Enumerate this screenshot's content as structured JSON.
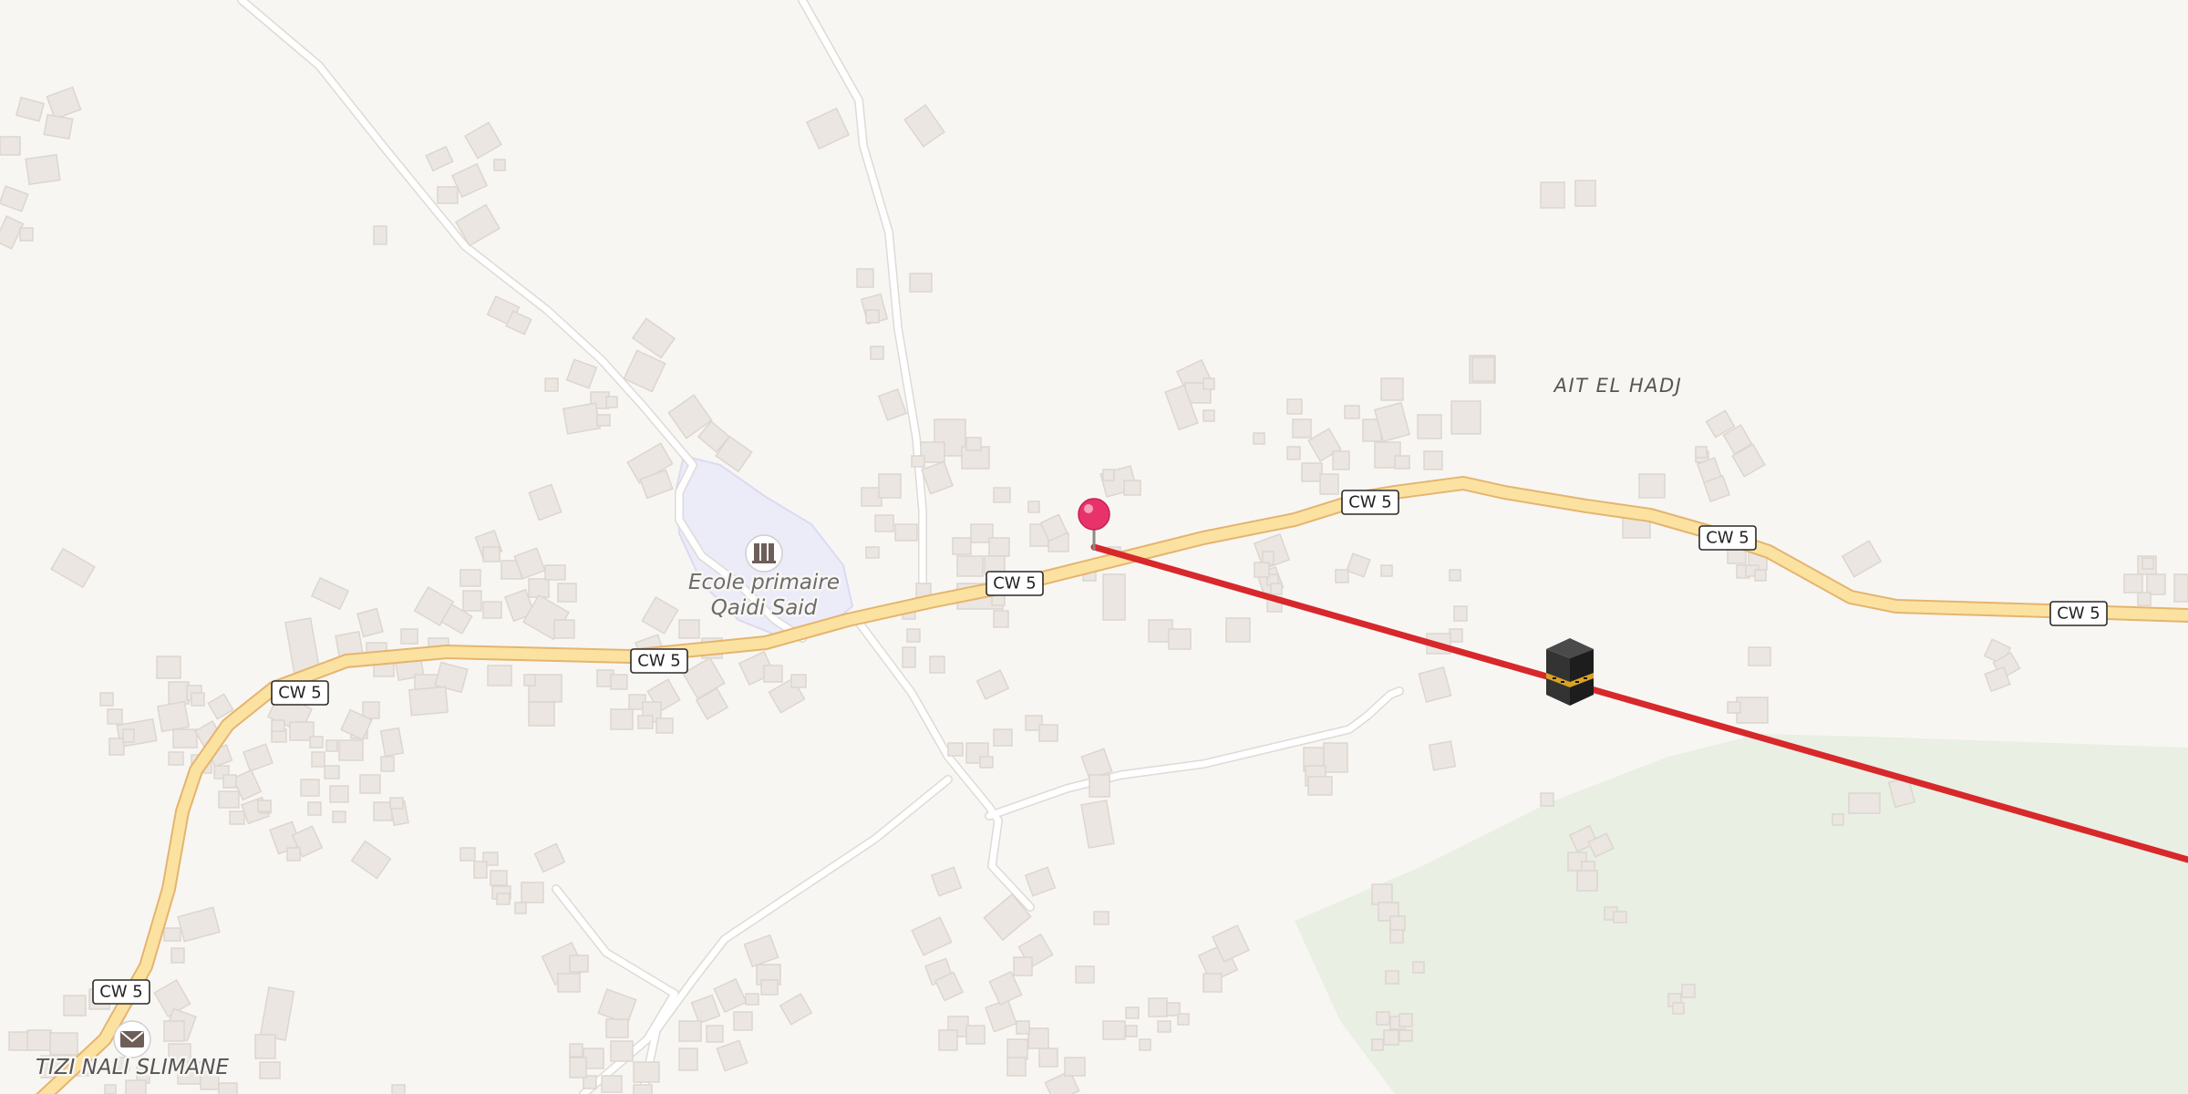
{
  "map": {
    "road_ref": "CW 5",
    "places": {
      "ait_el_hadj": "AIT EL HADJ",
      "tizi_nali_slimane": "TIZI NALI SLIMANE"
    },
    "poi": {
      "school_line1": "Ecole primaire",
      "school_line2": "Qaidi Said",
      "school_icon": "school-icon",
      "post_icon": "post-office-icon",
      "kaaba_icon": "kaaba-icon",
      "pin_icon": "map-pin-icon"
    },
    "colors": {
      "background": "#f8f6f3",
      "major_road": "#fbe2a0",
      "major_road_casing": "#e5b46f",
      "route_line": "#d7282b",
      "wood_area": "#e9efe2",
      "school_area": "#ecebf8",
      "pin": "#e8336a"
    }
  }
}
